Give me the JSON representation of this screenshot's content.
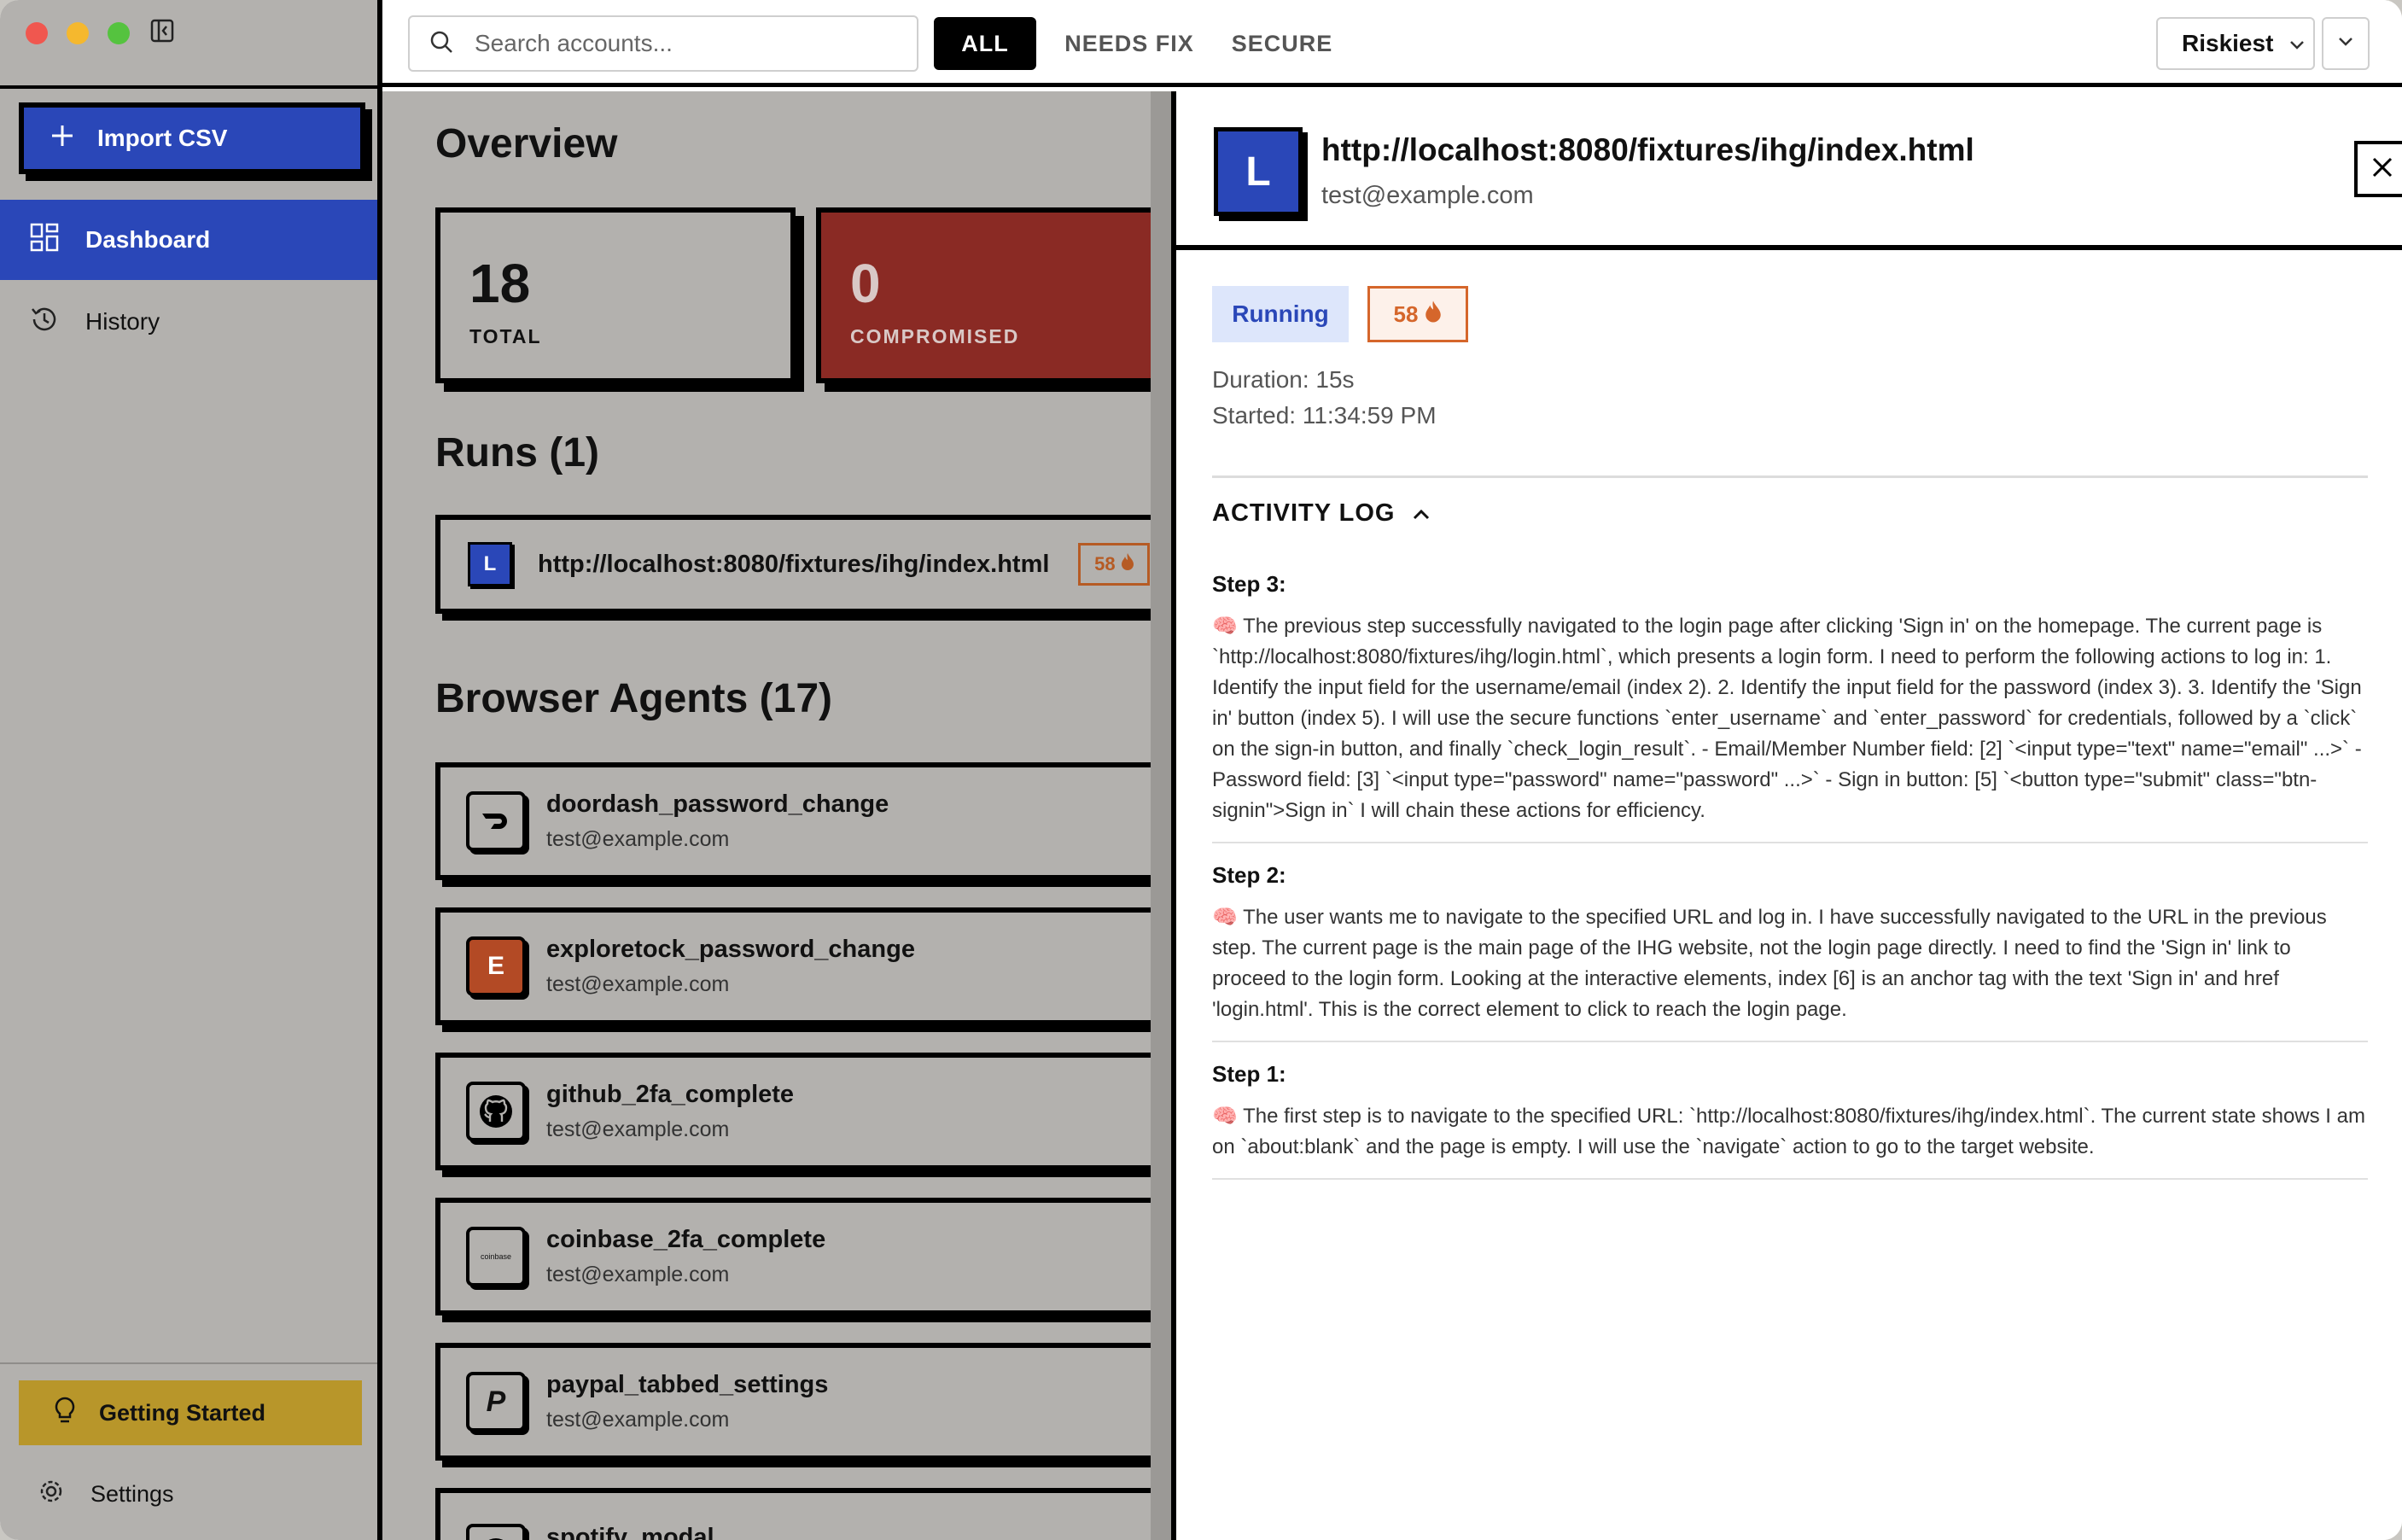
{
  "sidebar": {
    "import_label": "Import CSV",
    "nav": [
      {
        "label": "Dashboard",
        "active": true
      },
      {
        "label": "History",
        "active": false
      }
    ],
    "getting_started_label": "Getting Started",
    "settings_label": "Settings"
  },
  "topbar": {
    "search_placeholder": "Search accounts...",
    "filters": [
      "ALL",
      "NEEDS FIX",
      "SECURE"
    ],
    "active_filter": "ALL",
    "sort_value": "Riskiest"
  },
  "main": {
    "overview_title": "Overview",
    "stats": {
      "total_value": "18",
      "total_label": "TOTAL",
      "compromised_value": "0",
      "compromised_label": "COMPROMISED"
    },
    "runs_title": "Runs (1)",
    "run": {
      "avatar": "L",
      "url": "http://localhost:8080/fixtures/ihg/index.html",
      "score": "58"
    },
    "agents_title": "Browser Agents (17)",
    "agents": [
      {
        "name": "doordash_password_change",
        "email": "test@example.com",
        "logo": ""
      },
      {
        "name": "exploretock_password_change",
        "email": "test@example.com",
        "logo": "E"
      },
      {
        "name": "github_2fa_complete",
        "email": "test@example.com",
        "logo": ""
      },
      {
        "name": "coinbase_2fa_complete",
        "email": "test@example.com",
        "logo": "coinbase"
      },
      {
        "name": "paypal_tabbed_settings",
        "email": "test@example.com",
        "logo": "P"
      },
      {
        "name": "spotify_modal",
        "email": "",
        "logo": ""
      }
    ]
  },
  "panel": {
    "avatar": "L",
    "url": "http://localhost:8080/fixtures/ihg/index.html",
    "email": "test@example.com",
    "status": "Running",
    "score": "58",
    "duration": "Duration: 15s",
    "started": "Started: 11:34:59 PM",
    "log_title": "ACTIVITY LOG",
    "steps": [
      {
        "title": "Step 3:",
        "body": "🧠 The previous step successfully navigated to the login page after clicking 'Sign in' on the homepage. The current page is `http://localhost:8080/fixtures/ihg/login.html`, which presents a login form. I need to perform the following actions to log in: 1. Identify the input field for the username/email (index 2). 2. Identify the input field for the password (index 3). 3. Identify the 'Sign in' button (index 5). I will use the secure functions `enter_username` and `enter_password` for credentials, followed by a `click` on the sign-in button, and finally `check_login_result`. - Email/Member Number field: [2] `<input type=\"text\" name=\"email\" ...>` - Password field: [3] `<input type=\"password\" name=\"password\" ...>` - Sign in button: [5] `<button type=\"submit\" class=\"btn-signin\">Sign in` I will chain these actions for efficiency."
      },
      {
        "title": "Step 2:",
        "body": "🧠 The user wants me to navigate to the specified URL and log in. I have successfully navigated to the URL in the previous step. The current page is the main page of the IHG website, not the login page directly. I need to find the 'Sign in' link to proceed to the login form. Looking at the interactive elements, index [6] is an anchor tag with the text 'Sign in' and href 'login.html'. This is the correct element to click to reach the login page."
      },
      {
        "title": "Step 1:",
        "body": "🧠 The first step is to navigate to the specified URL: `http://localhost:8080/fixtures/ihg/index.html`. The current state shows I am on `about:blank` and the page is empty. I will use the `navigate` action to go to the target website."
      }
    ]
  },
  "colors": {
    "accent": "#2a47b8",
    "danger": "#8a2a24",
    "score": "#d5662b",
    "warning": "#b8962a"
  }
}
